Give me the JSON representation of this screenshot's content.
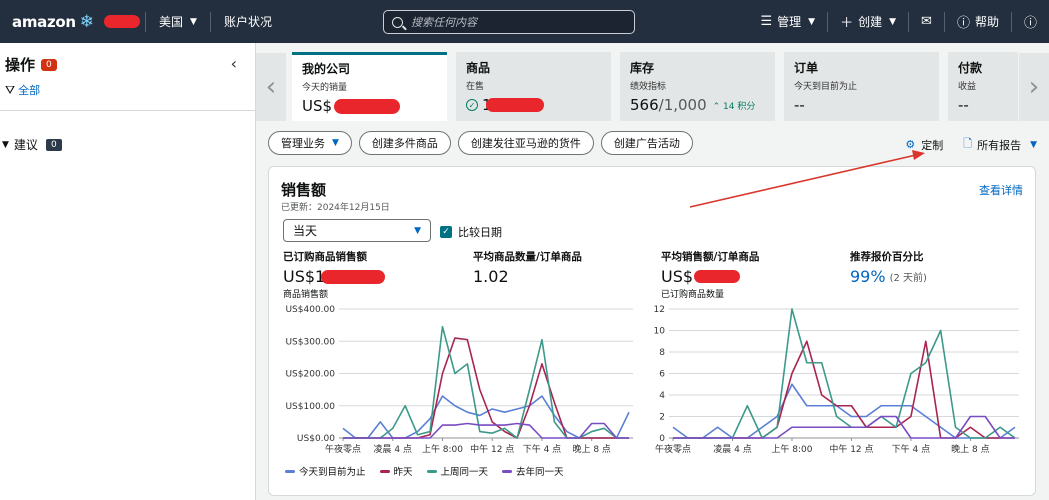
{
  "nav": {
    "logo": "amazon",
    "region": "美国",
    "account_status": "账户状况",
    "search_placeholder": "搜索任何内容",
    "manage": "管理",
    "create": "创建",
    "help": "帮助"
  },
  "sidebar": {
    "title": "操作",
    "count": "0",
    "filter": "全部",
    "suggest_label": "建议",
    "suggest_count": "0"
  },
  "kpis": [
    {
      "title": "我的公司",
      "sub": "今天的销量",
      "value": "US$"
    },
    {
      "title": "商品",
      "sub": "在售",
      "value": "1"
    },
    {
      "title": "库存",
      "sub": "绩效指标",
      "value": "566",
      "total": "/1,000",
      "delta": "14 积分"
    },
    {
      "title": "订单",
      "sub": "今天到目前为止",
      "value": "--"
    },
    {
      "title": "付款",
      "sub": "收益",
      "value": "--"
    }
  ],
  "toolbar": {
    "manage_business": "管理业务",
    "create_multi": "创建多件商品",
    "create_shipment": "创建发往亚马逊的货件",
    "create_ad": "创建广告活动",
    "customize": "定制",
    "all_reports": "所有报告"
  },
  "sales": {
    "title": "销售额",
    "updated": "已更新：2024年12月15日",
    "details_link": "查看详情",
    "period": "当天",
    "compare_label": "比较日期",
    "metrics": [
      {
        "label": "已订购商品销售额",
        "value": "US$1"
      },
      {
        "label": "平均商品数量/订单商品",
        "value": "1.02"
      },
      {
        "label": "平均销售额/订单商品",
        "value": "US$"
      },
      {
        "label": "推荐报价百分比",
        "value": "99%",
        "note": "(2 天前)"
      }
    ]
  },
  "chart_data": [
    {
      "type": "line",
      "title": "商品销售额",
      "x_labels": [
        "午夜零点",
        "凌晨 4 点",
        "上午 8:00",
        "中午 12 点",
        "下午 4 点",
        "晚上 8 点"
      ],
      "y_ticks": [
        "US$0.00",
        "US$100.00",
        "US$200.00",
        "US$300.00",
        "US$400.00"
      ],
      "ylim": [
        0,
        400
      ],
      "x_hours": [
        0,
        1,
        2,
        3,
        4,
        5,
        6,
        7,
        8,
        9,
        10,
        11,
        12,
        13,
        14,
        15,
        16,
        17,
        18,
        19,
        20,
        21,
        22,
        23
      ],
      "series": [
        {
          "name": "今天到目前为止",
          "color": "#5b7fd6",
          "values": [
            30,
            0,
            0,
            50,
            0,
            0,
            20,
            60,
            130,
            100,
            80,
            70,
            90,
            80,
            90,
            100,
            130,
            70,
            20,
            0,
            0,
            0,
            0,
            80
          ]
        },
        {
          "name": "昨天",
          "color": "#a8254f",
          "values": [
            0,
            0,
            0,
            0,
            0,
            0,
            0,
            10,
            200,
            310,
            305,
            150,
            50,
            20,
            0,
            100,
            230,
            110,
            0,
            0,
            0,
            0,
            0,
            0
          ]
        },
        {
          "name": "上周同一天",
          "color": "#3d9a8a",
          "values": [
            0,
            0,
            0,
            0,
            30,
            100,
            10,
            20,
            345,
            200,
            230,
            20,
            15,
            30,
            0,
            150,
            305,
            50,
            0,
            0,
            20,
            30,
            0,
            0
          ]
        },
        {
          "name": "去年同一天",
          "color": "#7a4cc2",
          "values": [
            0,
            0,
            0,
            0,
            0,
            0,
            0,
            0,
            40,
            40,
            45,
            40,
            40,
            40,
            45,
            40,
            0,
            0,
            0,
            0,
            45,
            45,
            0,
            0
          ]
        }
      ]
    },
    {
      "type": "line",
      "title": "已订购商品数量",
      "x_labels": [
        "午夜零点",
        "凌晨 4 点",
        "上午 8:00",
        "中午 12 点",
        "下午 4 点",
        "晚上 8 点"
      ],
      "y_ticks": [
        "0",
        "2",
        "4",
        "6",
        "8",
        "10",
        "12"
      ],
      "ylim": [
        0,
        12
      ],
      "x_hours": [
        0,
        1,
        2,
        3,
        4,
        5,
        6,
        7,
        8,
        9,
        10,
        11,
        12,
        13,
        14,
        15,
        16,
        17,
        18,
        19,
        20,
        21,
        22,
        23
      ],
      "series": [
        {
          "name": "今天到目前为止",
          "color": "#5b7fd6",
          "values": [
            1,
            0,
            0,
            1,
            0,
            0,
            1,
            2,
            5,
            3,
            3,
            3,
            2,
            2,
            3,
            3,
            3,
            2,
            1,
            0,
            0,
            0,
            0,
            1
          ]
        },
        {
          "name": "昨天",
          "color": "#a8254f",
          "values": [
            0,
            0,
            0,
            0,
            0,
            0,
            0,
            1,
            6,
            9,
            4,
            3,
            3,
            1,
            1,
            1,
            2,
            9,
            0,
            0,
            1,
            0,
            0,
            0
          ]
        },
        {
          "name": "上周同一天",
          "color": "#3d9a8a",
          "values": [
            0,
            0,
            0,
            0,
            0,
            3,
            0,
            1,
            12,
            7,
            7,
            2,
            1,
            1,
            2,
            1,
            6,
            7,
            10,
            1,
            0,
            0,
            1,
            0
          ]
        },
        {
          "name": "去年同一天",
          "color": "#7a4cc2",
          "values": [
            0,
            0,
            0,
            0,
            0,
            0,
            0,
            0,
            1,
            1,
            1,
            1,
            1,
            1,
            2,
            2,
            0,
            0,
            0,
            0,
            2,
            2,
            0,
            0
          ]
        }
      ]
    }
  ]
}
